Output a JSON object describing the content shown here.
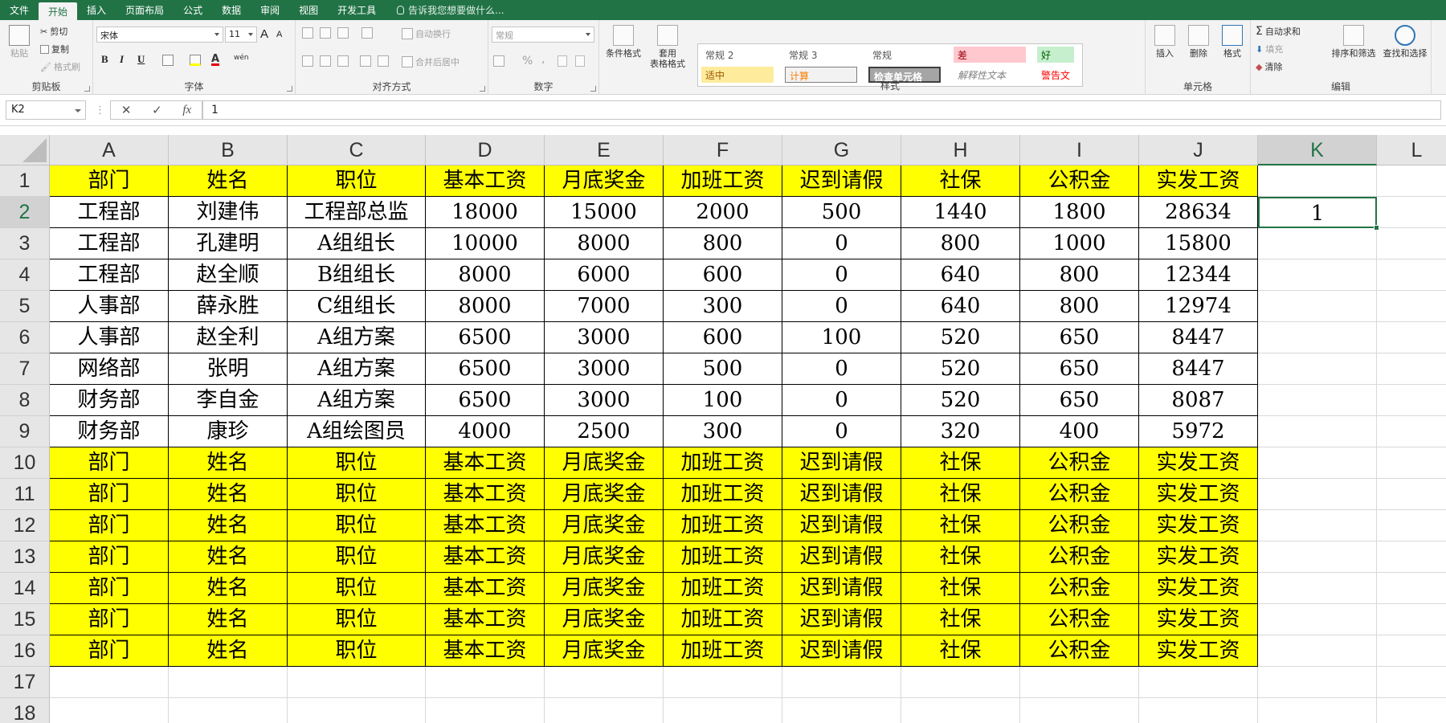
{
  "tabs": [
    "文件",
    "开始",
    "插入",
    "页面布局",
    "公式",
    "数据",
    "审阅",
    "视图",
    "开发工具"
  ],
  "tell_me": "告诉我您想要做什么...",
  "ribbon": {
    "clipboard": {
      "label": "剪贴板",
      "paste": "粘贴",
      "cut": "剪切",
      "copy": "复制",
      "format_painter": "格式刷"
    },
    "font": {
      "label": "字体",
      "name": "宋体",
      "size": "11",
      "bold": "B",
      "italic": "I",
      "underline": "U",
      "grow": "A",
      "shrink": "A",
      "wen": "wén"
    },
    "alignment": {
      "label": "对齐方式",
      "wrap": "自动换行",
      "merge": "合并后居中"
    },
    "number": {
      "label": "数字",
      "format": "常规",
      "percent": "%",
      "comma": ","
    },
    "cond": {
      "label1": "条件格式",
      "label2": "套用",
      "label3": "表格格式"
    },
    "styles": {
      "label": "样式",
      "items": [
        "常规 2",
        "常规 3",
        "常规",
        "差",
        "好",
        "适中",
        "计算",
        "检查单元格",
        "解释性文本",
        "警告文本"
      ]
    },
    "cells": {
      "label": "单元格",
      "insert": "插入",
      "delete": "删除",
      "format": "格式"
    },
    "editing": {
      "label": "编辑",
      "autosum": "自动求和",
      "fill": "填充",
      "clear": "清除",
      "sort": "排序和筛选",
      "find": "查找和选择"
    }
  },
  "formula_bar": {
    "name_box": "K2",
    "cancel": "✕",
    "enter": "✓",
    "fx": "fx",
    "value": "1"
  },
  "columns": [
    "A",
    "B",
    "C",
    "D",
    "E",
    "F",
    "G",
    "H",
    "I",
    "J",
    "K",
    "L"
  ],
  "rows": [
    "1",
    "2",
    "3",
    "4",
    "5",
    "6",
    "7",
    "8",
    "9",
    "10",
    "11",
    "12",
    "13",
    "14",
    "15",
    "16",
    "17",
    "18"
  ],
  "header": [
    "部门",
    "姓名",
    "职位",
    "基本工资",
    "月底奖金",
    "加班工资",
    "迟到请假",
    "社保",
    "公积金",
    "实发工资"
  ],
  "data_rows": [
    [
      "工程部",
      "刘建伟",
      "工程部总监",
      "18000",
      "15000",
      "2000",
      "500",
      "1440",
      "1800",
      "28634"
    ],
    [
      "工程部",
      "孔建明",
      "A组组长",
      "10000",
      "8000",
      "800",
      "0",
      "800",
      "1000",
      "15800"
    ],
    [
      "工程部",
      "赵全顺",
      "B组组长",
      "8000",
      "6000",
      "600",
      "0",
      "640",
      "800",
      "12344"
    ],
    [
      "人事部",
      "薛永胜",
      "C组组长",
      "8000",
      "7000",
      "300",
      "0",
      "640",
      "800",
      "12974"
    ],
    [
      "人事部",
      "赵全利",
      "A组方案",
      "6500",
      "3000",
      "600",
      "100",
      "520",
      "650",
      "8447"
    ],
    [
      "网络部",
      "张明",
      "A组方案",
      "6500",
      "3000",
      "500",
      "0",
      "520",
      "650",
      "8447"
    ],
    [
      "财务部",
      "李自金",
      "A组方案",
      "6500",
      "3000",
      "100",
      "0",
      "520",
      "650",
      "8087"
    ],
    [
      "财务部",
      "康珍",
      "A组绘图员",
      "4000",
      "2500",
      "300",
      "0",
      "320",
      "400",
      "5972"
    ]
  ],
  "repeated_header_rows": 7,
  "active_cell": {
    "ref": "K2",
    "value": "1"
  },
  "colors": {
    "accent": "#217346",
    "header_fill": "#ffff00"
  }
}
